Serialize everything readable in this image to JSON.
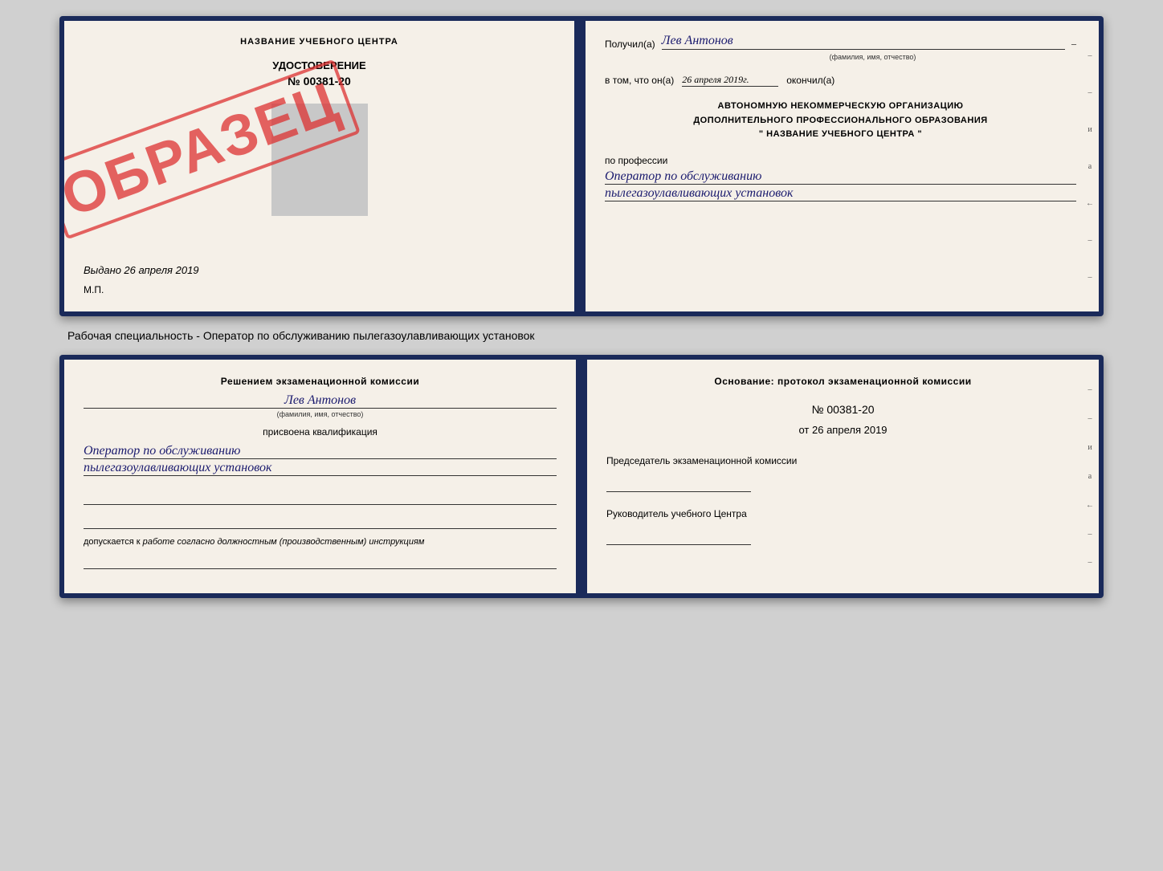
{
  "top_diploma": {
    "left": {
      "header": "НАЗВАНИЕ УЧЕБНОГО ЦЕНТРА",
      "cert_label": "УДОСТОВЕРЕНИЕ",
      "cert_number": "№ 00381-20",
      "stamp_text": "ОБРАЗЕЦ",
      "issued_prefix": "Выдано",
      "issued_date": "26 апреля 2019",
      "mp_label": "М.П."
    },
    "right": {
      "recipient_label": "Получил(а)",
      "recipient_name": "Лев Антонов",
      "fio_label": "(фамилия, имя, отчество)",
      "dash": "–",
      "date_prefix": "в том, что он(а)",
      "date_value": "26 апреля 2019г.",
      "finished_label": "окончил(а)",
      "org_line1": "АВТОНОМНУЮ НЕКОММЕРЧЕСКУЮ ОРГАНИЗАЦИЮ",
      "org_line2": "ДОПОЛНИТЕЛЬНОГО ПРОФЕССИОНАЛЬНОГО ОБРАЗОВАНИЯ",
      "org_line3": "\" НАЗВАНИЕ УЧЕБНОГО ЦЕНТРА \"",
      "profession_label": "по профессии",
      "profession_line1": "Оператор по обслуживанию",
      "profession_line2": "пылегазоулавливающих установок"
    }
  },
  "caption": "Рабочая специальность - Оператор по обслуживанию пылегазоулавливающих установок",
  "bottom_diploma": {
    "left": {
      "decision_header": "Решением экзаменационной комиссии",
      "decision_name": "Лев Антонов",
      "fio_label": "(фамилия, имя, отчество)",
      "assigned_label": "присвоена квалификация",
      "qual_line1": "Оператор по обслуживанию",
      "qual_line2": "пылегазоулавливающих установок",
      "допуск_prefix": "допускается к",
      "допуск_value": "работе согласно должностным (производственным) инструкциям"
    },
    "right": {
      "osnov_header": "Основание: протокол экзаменационной комиссии",
      "protocol_number": "№ 00381-20",
      "protocol_date_prefix": "от",
      "protocol_date": "26 апреля 2019",
      "chairman_label": "Председатель экзаменационной комиссии",
      "director_label": "Руководитель учебного Центра"
    }
  },
  "side_dashes": [
    "–",
    "–",
    "–",
    "–",
    "и",
    "а",
    "←",
    "–",
    "–",
    "–",
    "–"
  ],
  "side_dashes_bottom": [
    "–",
    "–",
    "–",
    "–",
    "и",
    "а",
    "←",
    "–",
    "–",
    "–",
    "–"
  ]
}
